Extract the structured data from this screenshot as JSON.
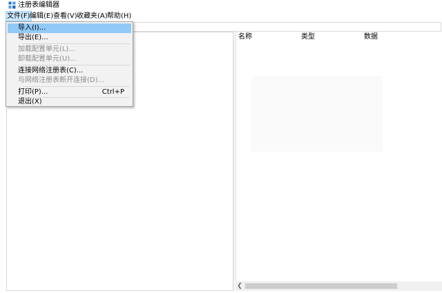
{
  "window": {
    "title": "注册表编辑器",
    "icon": "regedit-icon"
  },
  "menubar": {
    "items": [
      {
        "label": "文件(F)",
        "active": true
      },
      {
        "label": "编辑(E)",
        "active": false
      },
      {
        "label": "查看(V)",
        "active": false
      },
      {
        "label": "收藏夹(A)",
        "active": false
      },
      {
        "label": "帮助(H)",
        "active": false
      }
    ]
  },
  "file_menu": {
    "items": [
      {
        "label": "导入(I)...",
        "shortcut": "",
        "enabled": true,
        "highlighted": true
      },
      {
        "label": "导出(E)...",
        "shortcut": "",
        "enabled": true,
        "highlighted": false
      },
      {
        "label": "加载配置单元(L)...",
        "shortcut": "",
        "enabled": false,
        "highlighted": false
      },
      {
        "label": "卸载配置单元(U)...",
        "shortcut": "",
        "enabled": false,
        "highlighted": false
      },
      {
        "label": "连接网络注册表(C)...",
        "shortcut": "",
        "enabled": true,
        "highlighted": false
      },
      {
        "label": "与网络注册表断开连接(D)...",
        "shortcut": "",
        "enabled": false,
        "highlighted": false
      },
      {
        "label": "打印(P)...",
        "shortcut": "Ctrl+P",
        "enabled": true,
        "highlighted": false
      },
      {
        "label": "退出(X)",
        "shortcut": "",
        "enabled": true,
        "highlighted": false
      }
    ]
  },
  "list_view": {
    "columns": [
      "名称",
      "类型",
      "数据"
    ]
  },
  "colors": {
    "menu_highlight": "#91c9f7",
    "menubar_active": "#cce8ff",
    "disabled_text": "#8d8d8d"
  }
}
